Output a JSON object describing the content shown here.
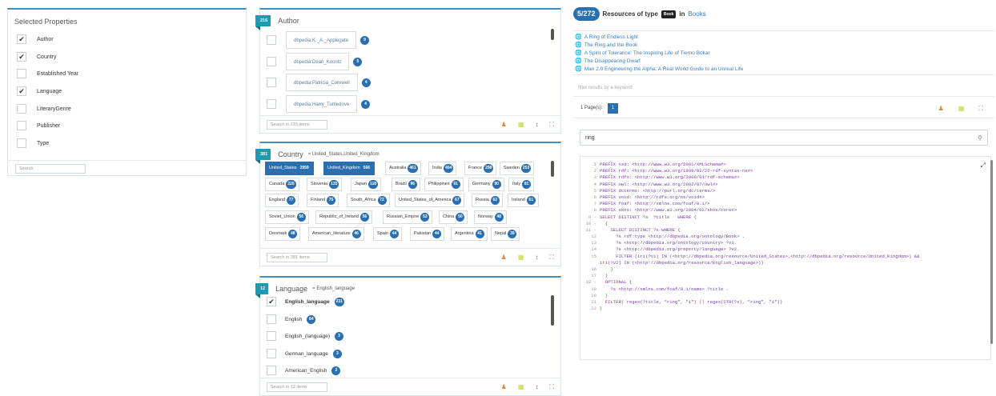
{
  "selected_properties": {
    "title": "Selected Properties",
    "items": [
      {
        "label": "Author",
        "checked": true
      },
      {
        "label": "Country",
        "checked": true
      },
      {
        "label": "Established Year",
        "checked": false
      },
      {
        "label": "Language",
        "checked": true
      },
      {
        "label": "LiteraryGenre",
        "checked": false
      },
      {
        "label": "Publisher",
        "checked": false
      },
      {
        "label": "Type",
        "checked": false
      }
    ],
    "search_placeholder": "Search"
  },
  "author_facet": {
    "count": "215",
    "title": "Author",
    "items": [
      {
        "label": "dbpedia:K._A._Applegate",
        "count": "9"
      },
      {
        "label": "dbpedia:Dean_Koontz",
        "count": "5"
      },
      {
        "label": "dbpedia:Patricia_Cornwell",
        "count": "4"
      },
      {
        "label": "dbpedia:Harry_Turtledove",
        "count": "4"
      }
    ],
    "search_placeholder": "Search in 215 items"
  },
  "country_facet": {
    "count": "381",
    "title": "Country",
    "filter": "= United_States,United_Kingdom",
    "tags": [
      {
        "label": "United_States",
        "count": "2959",
        "selected": true
      },
      {
        "label": "United_Kingdom",
        "count": "566",
        "selected": true
      },
      {
        "label": "Australia",
        "count": "461"
      },
      {
        "label": "India",
        "count": "404"
      },
      {
        "label": "France",
        "count": "298"
      },
      {
        "label": "Sweden",
        "count": "253"
      },
      {
        "label": "Canada",
        "count": "226"
      },
      {
        "label": "Slovenia",
        "count": "135"
      },
      {
        "label": "Japan",
        "count": "118"
      },
      {
        "label": "Brazil",
        "count": "96"
      },
      {
        "label": "Philippines",
        "count": "91"
      },
      {
        "label": "Germany",
        "count": "90"
      },
      {
        "label": "Italy",
        "count": "81"
      },
      {
        "label": "England",
        "count": "77"
      },
      {
        "label": "Finland",
        "count": "75"
      },
      {
        "label": "South_Africa",
        "count": "72"
      },
      {
        "label": "United_States_of_America",
        "count": "67"
      },
      {
        "label": "Russia",
        "count": "62"
      },
      {
        "label": "Ireland",
        "count": "61"
      },
      {
        "label": "Soviet_Union",
        "count": "56"
      },
      {
        "label": "Republic_of_Ireland",
        "count": "56"
      },
      {
        "label": "Russian_Empire",
        "count": "53"
      },
      {
        "label": "China",
        "count": "50"
      },
      {
        "label": "Norway",
        "count": "48"
      },
      {
        "label": "Denmark",
        "count": "48"
      },
      {
        "label": "American_literature",
        "count": "46"
      },
      {
        "label": "Spain",
        "count": "44"
      },
      {
        "label": "Pakistan",
        "count": "44"
      },
      {
        "label": "Argentina",
        "count": "41"
      },
      {
        "label": "Nepal",
        "count": "39"
      }
    ],
    "search_placeholder": "Search in 381 items"
  },
  "language_facet": {
    "count": "12",
    "title": "Language",
    "filter": "= English_language",
    "items": [
      {
        "label": "English_language",
        "count": "231",
        "checked": true
      },
      {
        "label": "English",
        "count": "84",
        "checked": false
      },
      {
        "label": "English_(language)",
        "count": "3",
        "checked": false
      },
      {
        "label": "German_language",
        "count": "3",
        "checked": false
      },
      {
        "label": "American_English",
        "count": "2",
        "checked": false
      }
    ],
    "search_placeholder": "Search in 12 items"
  },
  "results": {
    "count": "5/272",
    "text_before": "Resources of type",
    "type_badge": "Book",
    "text_in": "in",
    "dataset_link": "Books",
    "items": [
      "A Ring of Endless Light",
      "The Ring and the Book",
      "A Spirit of Tolerance: The Inspiring Life of Tierno Bokar",
      "The Disappearing Dwarf",
      "Man 2.0 Engineering the Alpha: A Real World Guide to an Unreal Life"
    ],
    "filter_placeholder": "filter results by a keyword",
    "pages_label": "1 Page(s):",
    "current_page": "1",
    "keyword": "ring"
  },
  "sparql": {
    "lines": [
      {
        "n": "1",
        "t": "PREFIX xsd: <http://www.w3.org/2001/XMLSchema#>"
      },
      {
        "n": "2",
        "t": "PREFIX rdf: <http://www.w3.org/1999/02/22-rdf-syntax-ns#>"
      },
      {
        "n": "3",
        "t": "PREFIX rdfs: <http://www.w3.org/2000/01/rdf-schema#>"
      },
      {
        "n": "4",
        "t": "PREFIX owl: <http://www.w3.org/2002/07/owl#>"
      },
      {
        "n": "5",
        "t": "PREFIX dcterms: <http://purl.org/dc/terms/>"
      },
      {
        "n": "6",
        "t": "PREFIX void: <http://rdfs.org/ns/void#>"
      },
      {
        "n": "7",
        "t": "PREFIX foaf: <http://xmlns.com/foaf/0.1/>"
      },
      {
        "n": "8",
        "t": "PREFIX skos: <http://www.w3.org/2004/02/skos/core#>"
      },
      {
        "n": "9 -",
        "t": "SELECT DISTINCT ?s  ?title   WHERE {"
      },
      {
        "n": "10 -",
        "t": "  {"
      },
      {
        "n": "11 -",
        "t": "    SELECT DISTINCT ?s WHERE {"
      },
      {
        "n": "12",
        "t": "      ?s rdf:type <http://dbpedia.org/ontology/Book> ."
      },
      {
        "n": "13",
        "t": "      ?s <http://dbpedia.org/ontology/country> ?v1."
      },
      {
        "n": "14",
        "t": "      ?s <http://dbpedia.org/property/language> ?v2."
      },
      {
        "n": "15",
        "t": "      FILTER (iri(?v1) IN (<http://dbpedia.org/resource/United_States>,<http://dbpedia.org/resource/United_Kingdom>) &&"
      },
      {
        "n": "",
        "t": "iri(?v2) IN (<http://dbpedia.org/resource/English_language>))"
      },
      {
        "n": "16",
        "t": "    }"
      },
      {
        "n": "17",
        "t": "  }"
      },
      {
        "n": "18 -",
        "t": "  OPTIONAL {"
      },
      {
        "n": "19",
        "t": "    ?s <http://xmlns.com/foaf/0.1/name> ?title ."
      },
      {
        "n": "20",
        "t": "  }"
      },
      {
        "n": "21",
        "t": "  FILTER( regex(?title, \"ring\", \"i\") || regex(STR(?s), \"ring\", \"i\"))"
      },
      {
        "n": "22",
        "t": "}"
      }
    ]
  },
  "icons": {
    "user": "user-icon",
    "grid": "grid-icon",
    "sort": "sort-icon",
    "expand": "expand-icon",
    "globe": "globe-icon",
    "search": "search-icon"
  },
  "colors": {
    "accent": "#2a6fb0",
    "header_badge": "#1e9bb0",
    "code_keyword": "#7a3aa5"
  }
}
